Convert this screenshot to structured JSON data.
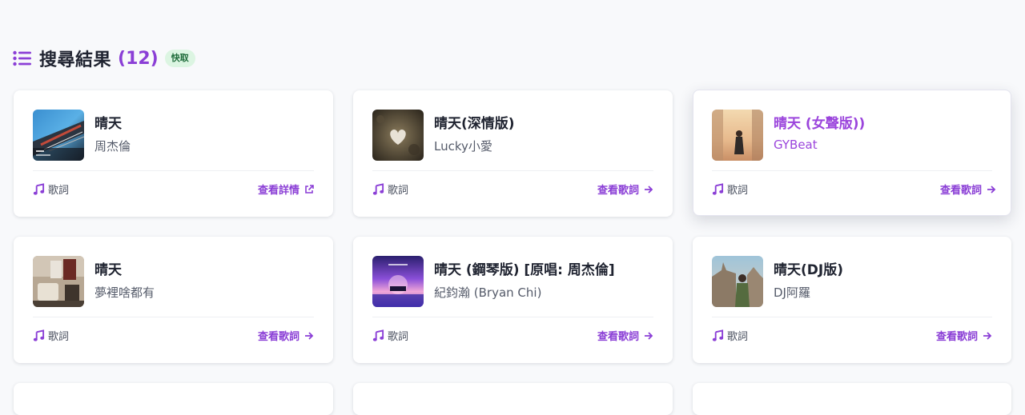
{
  "header": {
    "title": "搜尋結果",
    "count": "(12)",
    "badge": "快取"
  },
  "colors": {
    "accent": "#8b3fd6",
    "badge_bg": "#dcf5e2",
    "badge_text": "#1e6b3a"
  },
  "results": [
    {
      "title": "晴天",
      "artist": "周杰倫",
      "tag": "歌詞",
      "action": "查看詳情",
      "action_icon": "external-link-icon"
    },
    {
      "title": "晴天(深情版)",
      "artist": "Lucky小愛",
      "tag": "歌詞",
      "action": "查看歌詞",
      "action_icon": "arrow-right-icon"
    },
    {
      "title": "晴天 (女聲版))",
      "artist": "GYBeat",
      "tag": "歌詞",
      "action": "查看歌詞",
      "action_icon": "arrow-right-icon"
    },
    {
      "title": "晴天",
      "artist": "夢裡啥都有",
      "tag": "歌詞",
      "action": "查看歌詞",
      "action_icon": "arrow-right-icon"
    },
    {
      "title": "晴天 (鋼琴版) [原唱: 周杰倫]",
      "artist": "紀鈞瀚 (Bryan Chi)",
      "tag": "歌詞",
      "action": "查看歌詞",
      "action_icon": "arrow-right-icon"
    },
    {
      "title": "晴天(DJ版)",
      "artist": "DJ阿羅",
      "tag": "歌詞",
      "action": "查看歌詞",
      "action_icon": "arrow-right-icon"
    }
  ]
}
